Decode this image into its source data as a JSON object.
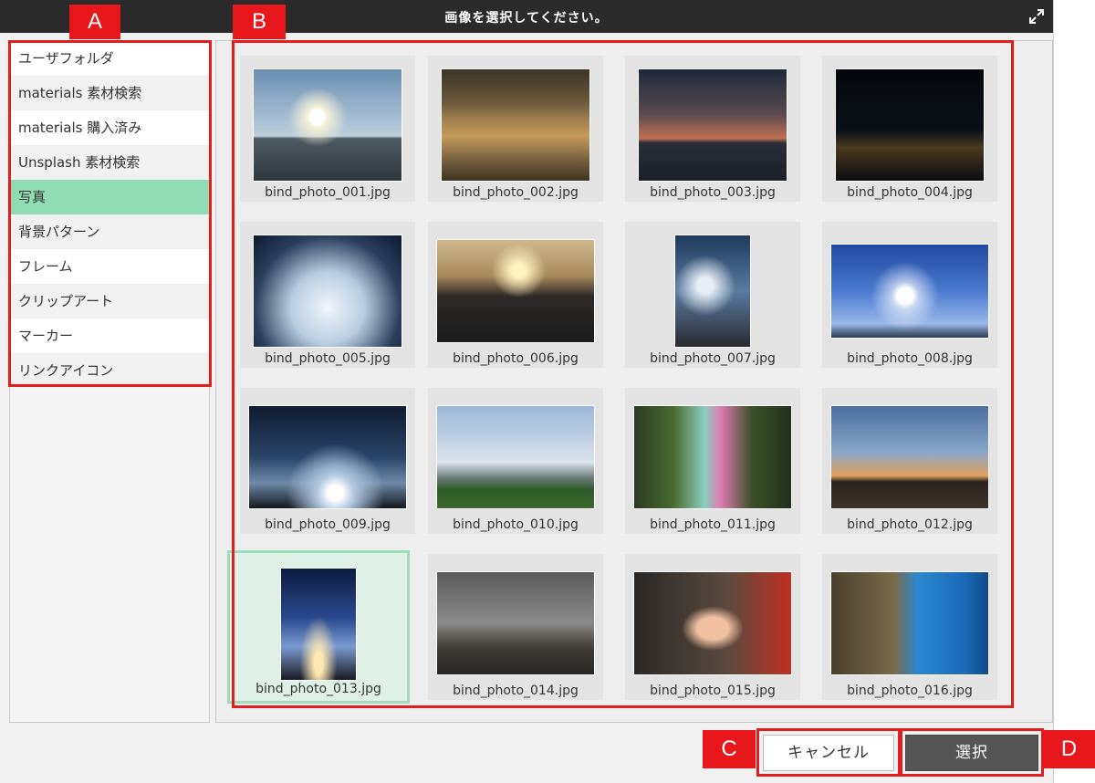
{
  "dialog": {
    "title": "画像を選択してください。"
  },
  "sidebar": {
    "items": [
      {
        "label": "ユーザフォルダ",
        "active": false
      },
      {
        "label": "materials 素材検索",
        "active": false
      },
      {
        "label": "materials 購入済み",
        "active": false
      },
      {
        "label": "Unsplash 素材検索",
        "active": false
      },
      {
        "label": "写真",
        "active": true
      },
      {
        "label": "背景パターン",
        "active": false
      },
      {
        "label": "フレーム",
        "active": false
      },
      {
        "label": "クリップアート",
        "active": false
      },
      {
        "label": "マーカー",
        "active": false
      },
      {
        "label": "リンクアイコン",
        "active": false
      }
    ]
  },
  "images": [
    {
      "filename": "bind_photo_001.jpg",
      "selected": false
    },
    {
      "filename": "bind_photo_002.jpg",
      "selected": false
    },
    {
      "filename": "bind_photo_003.jpg",
      "selected": false
    },
    {
      "filename": "bind_photo_004.jpg",
      "selected": false
    },
    {
      "filename": "bind_photo_005.jpg",
      "selected": false
    },
    {
      "filename": "bind_photo_006.jpg",
      "selected": false
    },
    {
      "filename": "bind_photo_007.jpg",
      "selected": false
    },
    {
      "filename": "bind_photo_008.jpg",
      "selected": false
    },
    {
      "filename": "bind_photo_009.jpg",
      "selected": false
    },
    {
      "filename": "bind_photo_010.jpg",
      "selected": false
    },
    {
      "filename": "bind_photo_011.jpg",
      "selected": false
    },
    {
      "filename": "bind_photo_012.jpg",
      "selected": false
    },
    {
      "filename": "bind_photo_013.jpg",
      "selected": true
    },
    {
      "filename": "bind_photo_014.jpg",
      "selected": false
    },
    {
      "filename": "bind_photo_015.jpg",
      "selected": false
    },
    {
      "filename": "bind_photo_016.jpg",
      "selected": false
    }
  ],
  "buttons": {
    "cancel_label": "キャンセル",
    "select_label": "選択"
  },
  "annotations": {
    "a": "A",
    "b": "B",
    "c": "C",
    "d": "D"
  },
  "colors": {
    "titlebar": "#2b2b2b",
    "active_item": "#90dbb3",
    "selected_tile": "#dff1e6",
    "annotation_red": "#e01e1e",
    "select_button": "#555555"
  }
}
